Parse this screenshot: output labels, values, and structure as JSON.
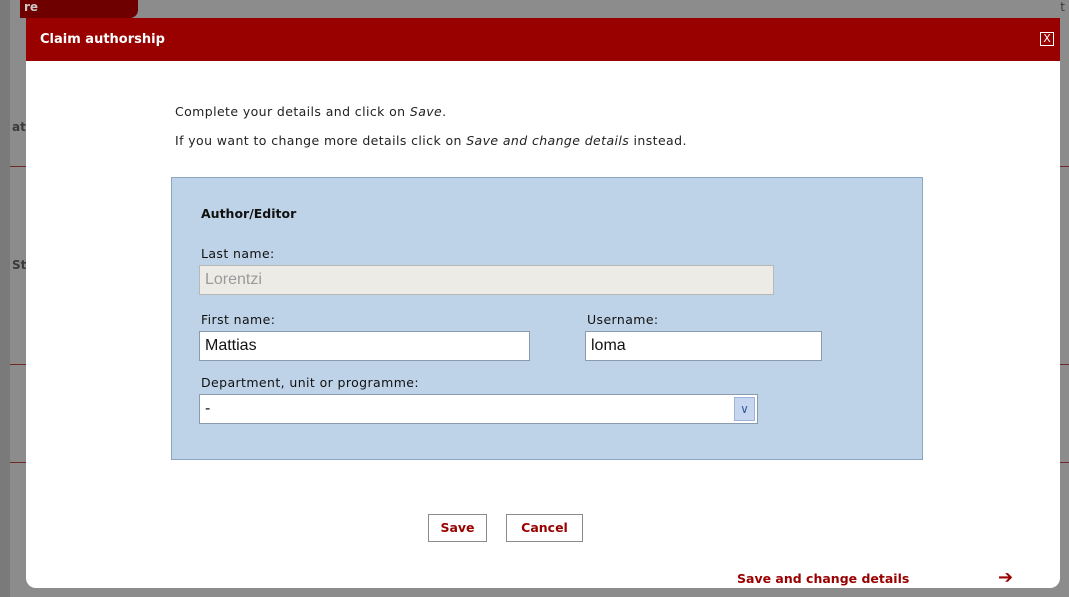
{
  "background": {
    "tab_label": "re",
    "side_text_1": "at",
    "side_text_2": "St",
    "top_right_text": "t"
  },
  "dialog": {
    "title": "Claim authorship",
    "close_label": "X",
    "intro_line1_prefix": "Complete your details and click on ",
    "intro_line1_em": "Save",
    "intro_line1_suffix": ".",
    "intro_line2_prefix": "If you want to change more details click on ",
    "intro_line2_em": "Save and change details",
    "intro_line2_suffix": " instead."
  },
  "form": {
    "heading": "Author/Editor",
    "last_name": {
      "label": "Last name:",
      "value": "Lorentzi"
    },
    "first_name": {
      "label": "First name:",
      "value": "Mattias"
    },
    "username": {
      "label": "Username:",
      "value": "loma"
    },
    "department": {
      "label": "Department, unit or programme:",
      "value": "-"
    }
  },
  "buttons": {
    "save": "Save",
    "cancel": "Cancel",
    "save_and_change": "Save and change details"
  },
  "icons": {
    "close": "close-icon",
    "select_arrow": "chevron-down-icon",
    "forward_arrow": "arrow-right-icon"
  },
  "colors": {
    "brand_red": "#990000",
    "panel_blue": "#bfd3e8"
  }
}
